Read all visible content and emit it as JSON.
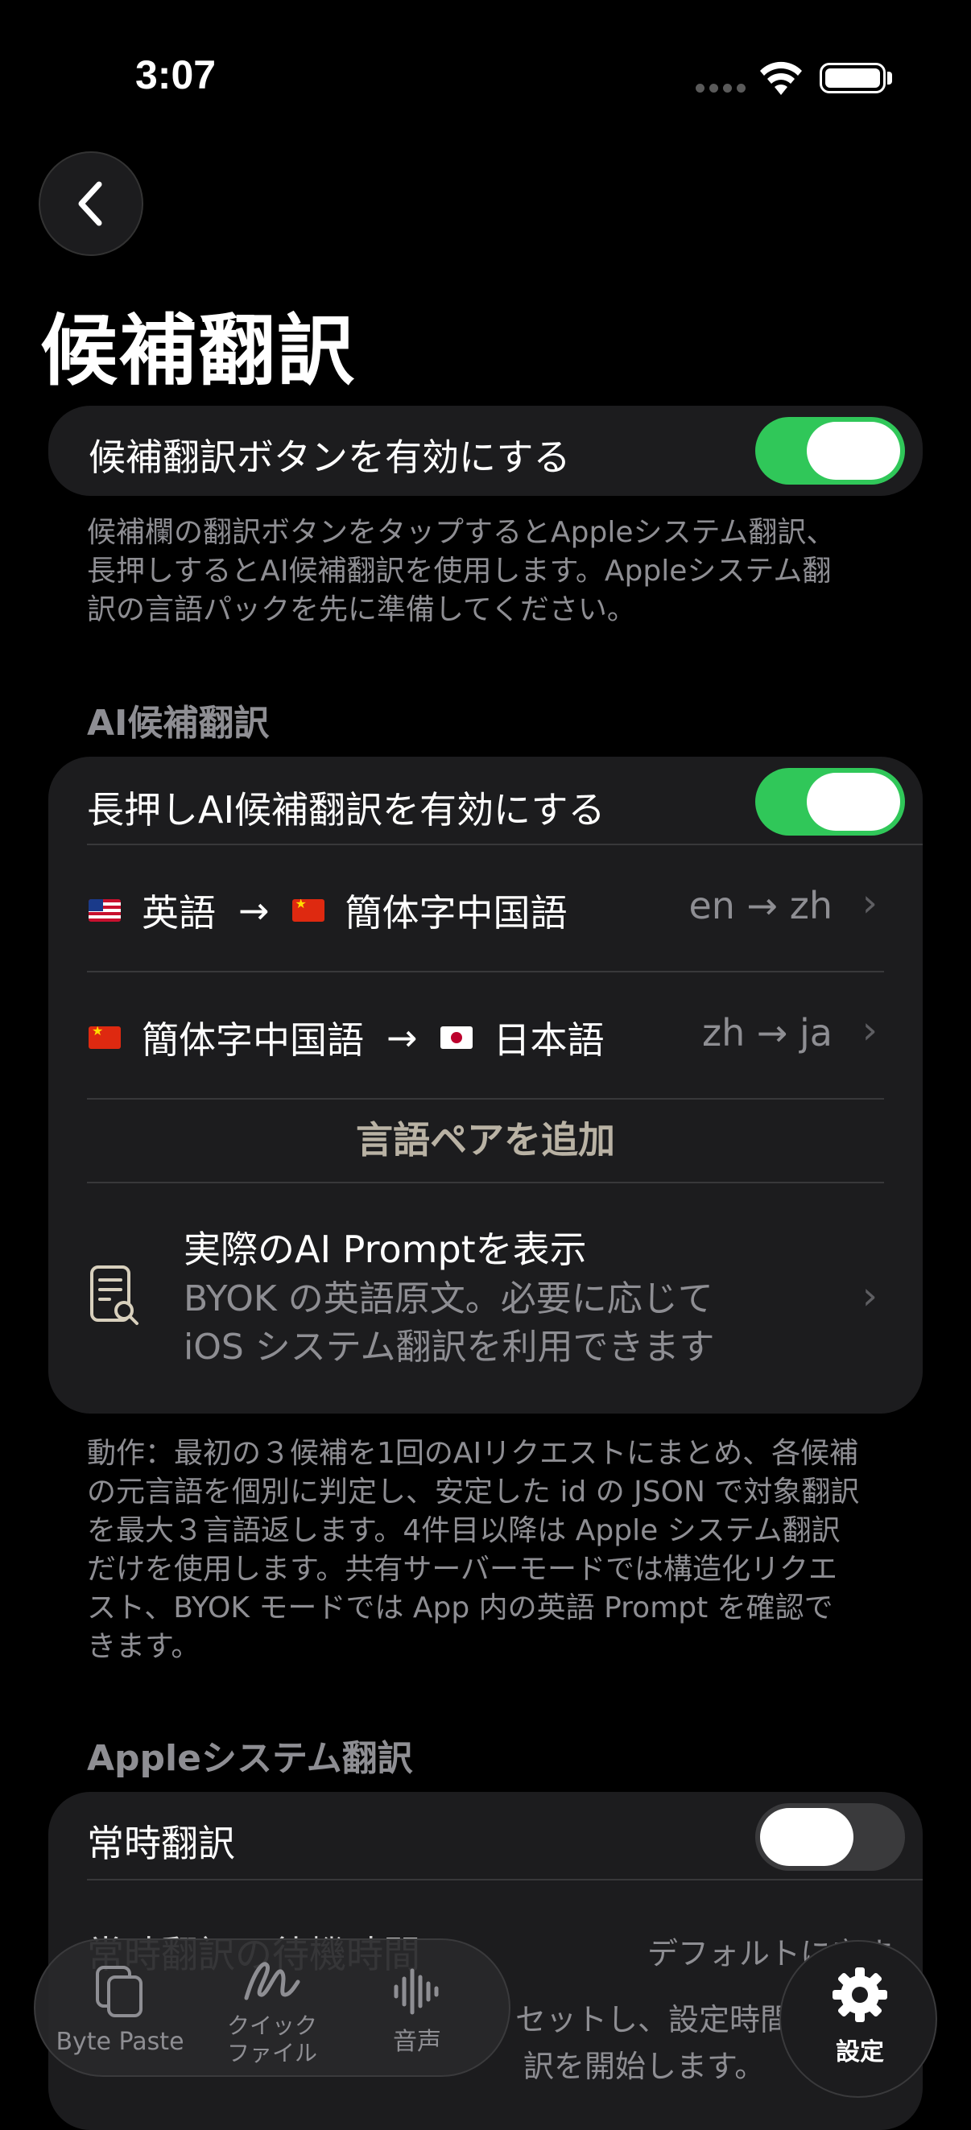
{
  "status_bar": {
    "time": "3:07"
  },
  "page": {
    "title": "候補翻訳"
  },
  "main_toggle": {
    "label": "候補翻訳ボタンを有効にする",
    "on": true
  },
  "main_note": "候補欄の翻訳ボタンをタップするとAppleシステム翻訳、長押しするとAI候補翻訳を使用します。Appleシステム翻訳の言語パックを先に準備してください。",
  "ai_section": {
    "header": "AI候補翻訳",
    "toggle_label": "長押しAI候補翻訳を有効にする",
    "toggle_on": true,
    "pairs": [
      {
        "from_flag": "us-flag",
        "from": "英語",
        "arrow": "→",
        "to_flag": "cn-flag",
        "to": "簡体字中国語",
        "code": "en → zh"
      },
      {
        "from_flag": "cn-flag",
        "from": "簡体字中国語",
        "arrow": "→",
        "to_flag": "jp-flag",
        "to": "日本語",
        "code": "zh → ja"
      }
    ],
    "add_pair": "言語ペアを追加",
    "prompt_title": "実際のAI Promptを表示",
    "prompt_subtitle": "BYOK の英語原文。必要に応じて iOS システム翻訳を利用できます",
    "note": "動作：最初の３候補を1回のAIリクエストにまとめ、各候補の元言語を個別に判定し、安定した id の JSON で対象翻訳を最大３言語返します。4件目以降は Apple システム翻訳だけを使用します。共有サーバーモードでは構造化リクエスト、BYOK モードでは App 内の英語 Prompt を確認できます。"
  },
  "apple_section": {
    "header": "Appleシステム翻訳",
    "toggle_label": "常時翻訳",
    "toggle_on": false,
    "partial_row_label": "常時翻訳の待機時間",
    "partial_row_value": "デフォルトに戻す",
    "partial_note": "セットし、設定時間の",
    "partial_note_2": "訳を開始します。"
  },
  "tabbar": {
    "tabs": [
      {
        "label": "Byte Paste",
        "icon": "clipboard-icon"
      },
      {
        "label": "クイック\nファイル",
        "icon": "scribble-icon"
      },
      {
        "label": "音声",
        "icon": "waveform-icon"
      }
    ],
    "settings_label": "設定"
  }
}
